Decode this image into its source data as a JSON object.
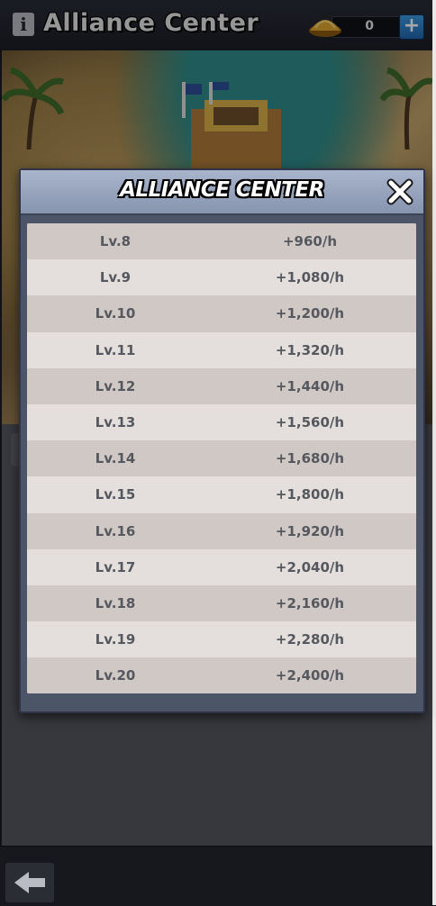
{
  "header": {
    "title": "Alliance Center",
    "currency_amount": "0",
    "info_icon": "info-icon",
    "coin_icon": "gold-pile-icon",
    "plus_icon": "plus-icon"
  },
  "modal": {
    "title": "ALLIANCE CENTER",
    "close_icon": "close-icon",
    "rows": [
      {
        "level": "Lv.8",
        "value": "+960/h"
      },
      {
        "level": "Lv.9",
        "value": "+1,080/h"
      },
      {
        "level": "Lv.10",
        "value": "+1,200/h"
      },
      {
        "level": "Lv.11",
        "value": "+1,320/h"
      },
      {
        "level": "Lv.12",
        "value": "+1,440/h"
      },
      {
        "level": "Lv.13",
        "value": "+1,560/h"
      },
      {
        "level": "Lv.14",
        "value": "+1,680/h"
      },
      {
        "level": "Lv.15",
        "value": "+1,800/h"
      },
      {
        "level": "Lv.16",
        "value": "+1,920/h"
      },
      {
        "level": "Lv.17",
        "value": "+2,040/h"
      },
      {
        "level": "Lv.18",
        "value": "+2,160/h"
      },
      {
        "level": "Lv.19",
        "value": "+2,280/h"
      },
      {
        "level": "Lv.20",
        "value": "+2,400/h"
      }
    ]
  },
  "footer": {
    "back_icon": "back-arrow-icon"
  },
  "colors": {
    "accent_blue": "#2f7fcf",
    "modal_header": "#9aa6bf",
    "row_dark": "#cfc8c4",
    "row_light": "#e4dfdc",
    "text_gray": "#55585f"
  }
}
